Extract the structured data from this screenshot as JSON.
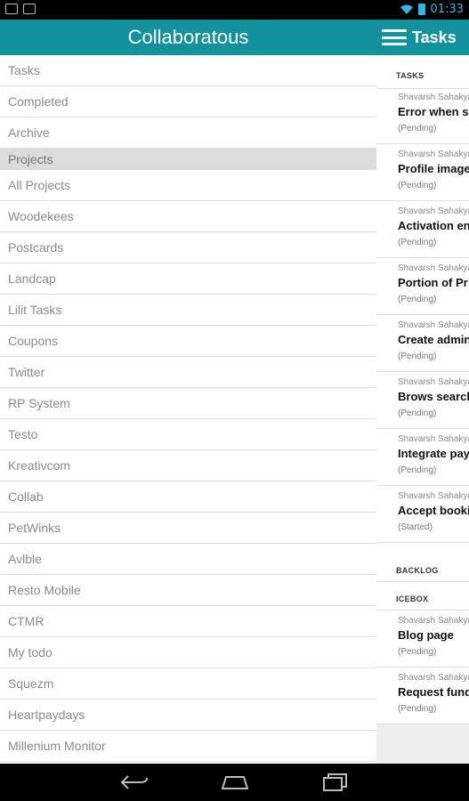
{
  "status_bar": {
    "time": "01:33"
  },
  "drawer": {
    "title": "Collaboratous",
    "top_items": [
      "Tasks",
      "Completed",
      "Archive"
    ],
    "projects_header": "Projects",
    "projects": [
      "All Projects",
      "Woodekees",
      "Postcards",
      "Landcap",
      "Lilit Tasks",
      "Coupons",
      "Twitter",
      "RP System",
      "Testo",
      "Kreativcom",
      "Collab",
      "PetWinks",
      "Avlble",
      "Resto Mobile",
      "CTMR",
      "My todo",
      "Squezm",
      "Heartpaydays",
      "Millenium Monitor"
    ]
  },
  "main": {
    "title": "Tasks",
    "groups": {
      "tasks_label": "TASKS",
      "backlog_label": "BACKLOG",
      "icebox_label": "ICEBOX"
    },
    "tasks": [
      {
        "who": "Shavarsh Sahakyan",
        "title": "Error when s",
        "status": "(Pending)"
      },
      {
        "who": "Shavarsh Sahakyan",
        "title": "Profile image",
        "status": "(Pending)"
      },
      {
        "who": "Shavarsh Sahakyan",
        "title": "Activation en",
        "status": "(Pending)"
      },
      {
        "who": "Shavarsh Sahakyan",
        "title": "Portion of Pr",
        "status": "(Pending)"
      },
      {
        "who": "Shavarsh Sahakyan",
        "title": "Create admin",
        "status": "(Pending)"
      },
      {
        "who": "Shavarsh Sahakyan",
        "title": "Brows search",
        "status": "(Pending)"
      },
      {
        "who": "Shavarsh Sahakyan",
        "title": "Integrate pay",
        "status": "(Pending)"
      },
      {
        "who": "Shavarsh Sahakyan",
        "title": "Accept booki",
        "status": "(Started)"
      }
    ],
    "icebox": [
      {
        "who": "Shavarsh Sahakyan",
        "title": "Blog page",
        "status": "(Pending)"
      },
      {
        "who": "Shavarsh Sahakyan",
        "title": "Request fund",
        "status": "(Pending)"
      }
    ]
  },
  "nav": {
    "icons": [
      "back-icon",
      "home-icon",
      "recents-icon"
    ]
  }
}
